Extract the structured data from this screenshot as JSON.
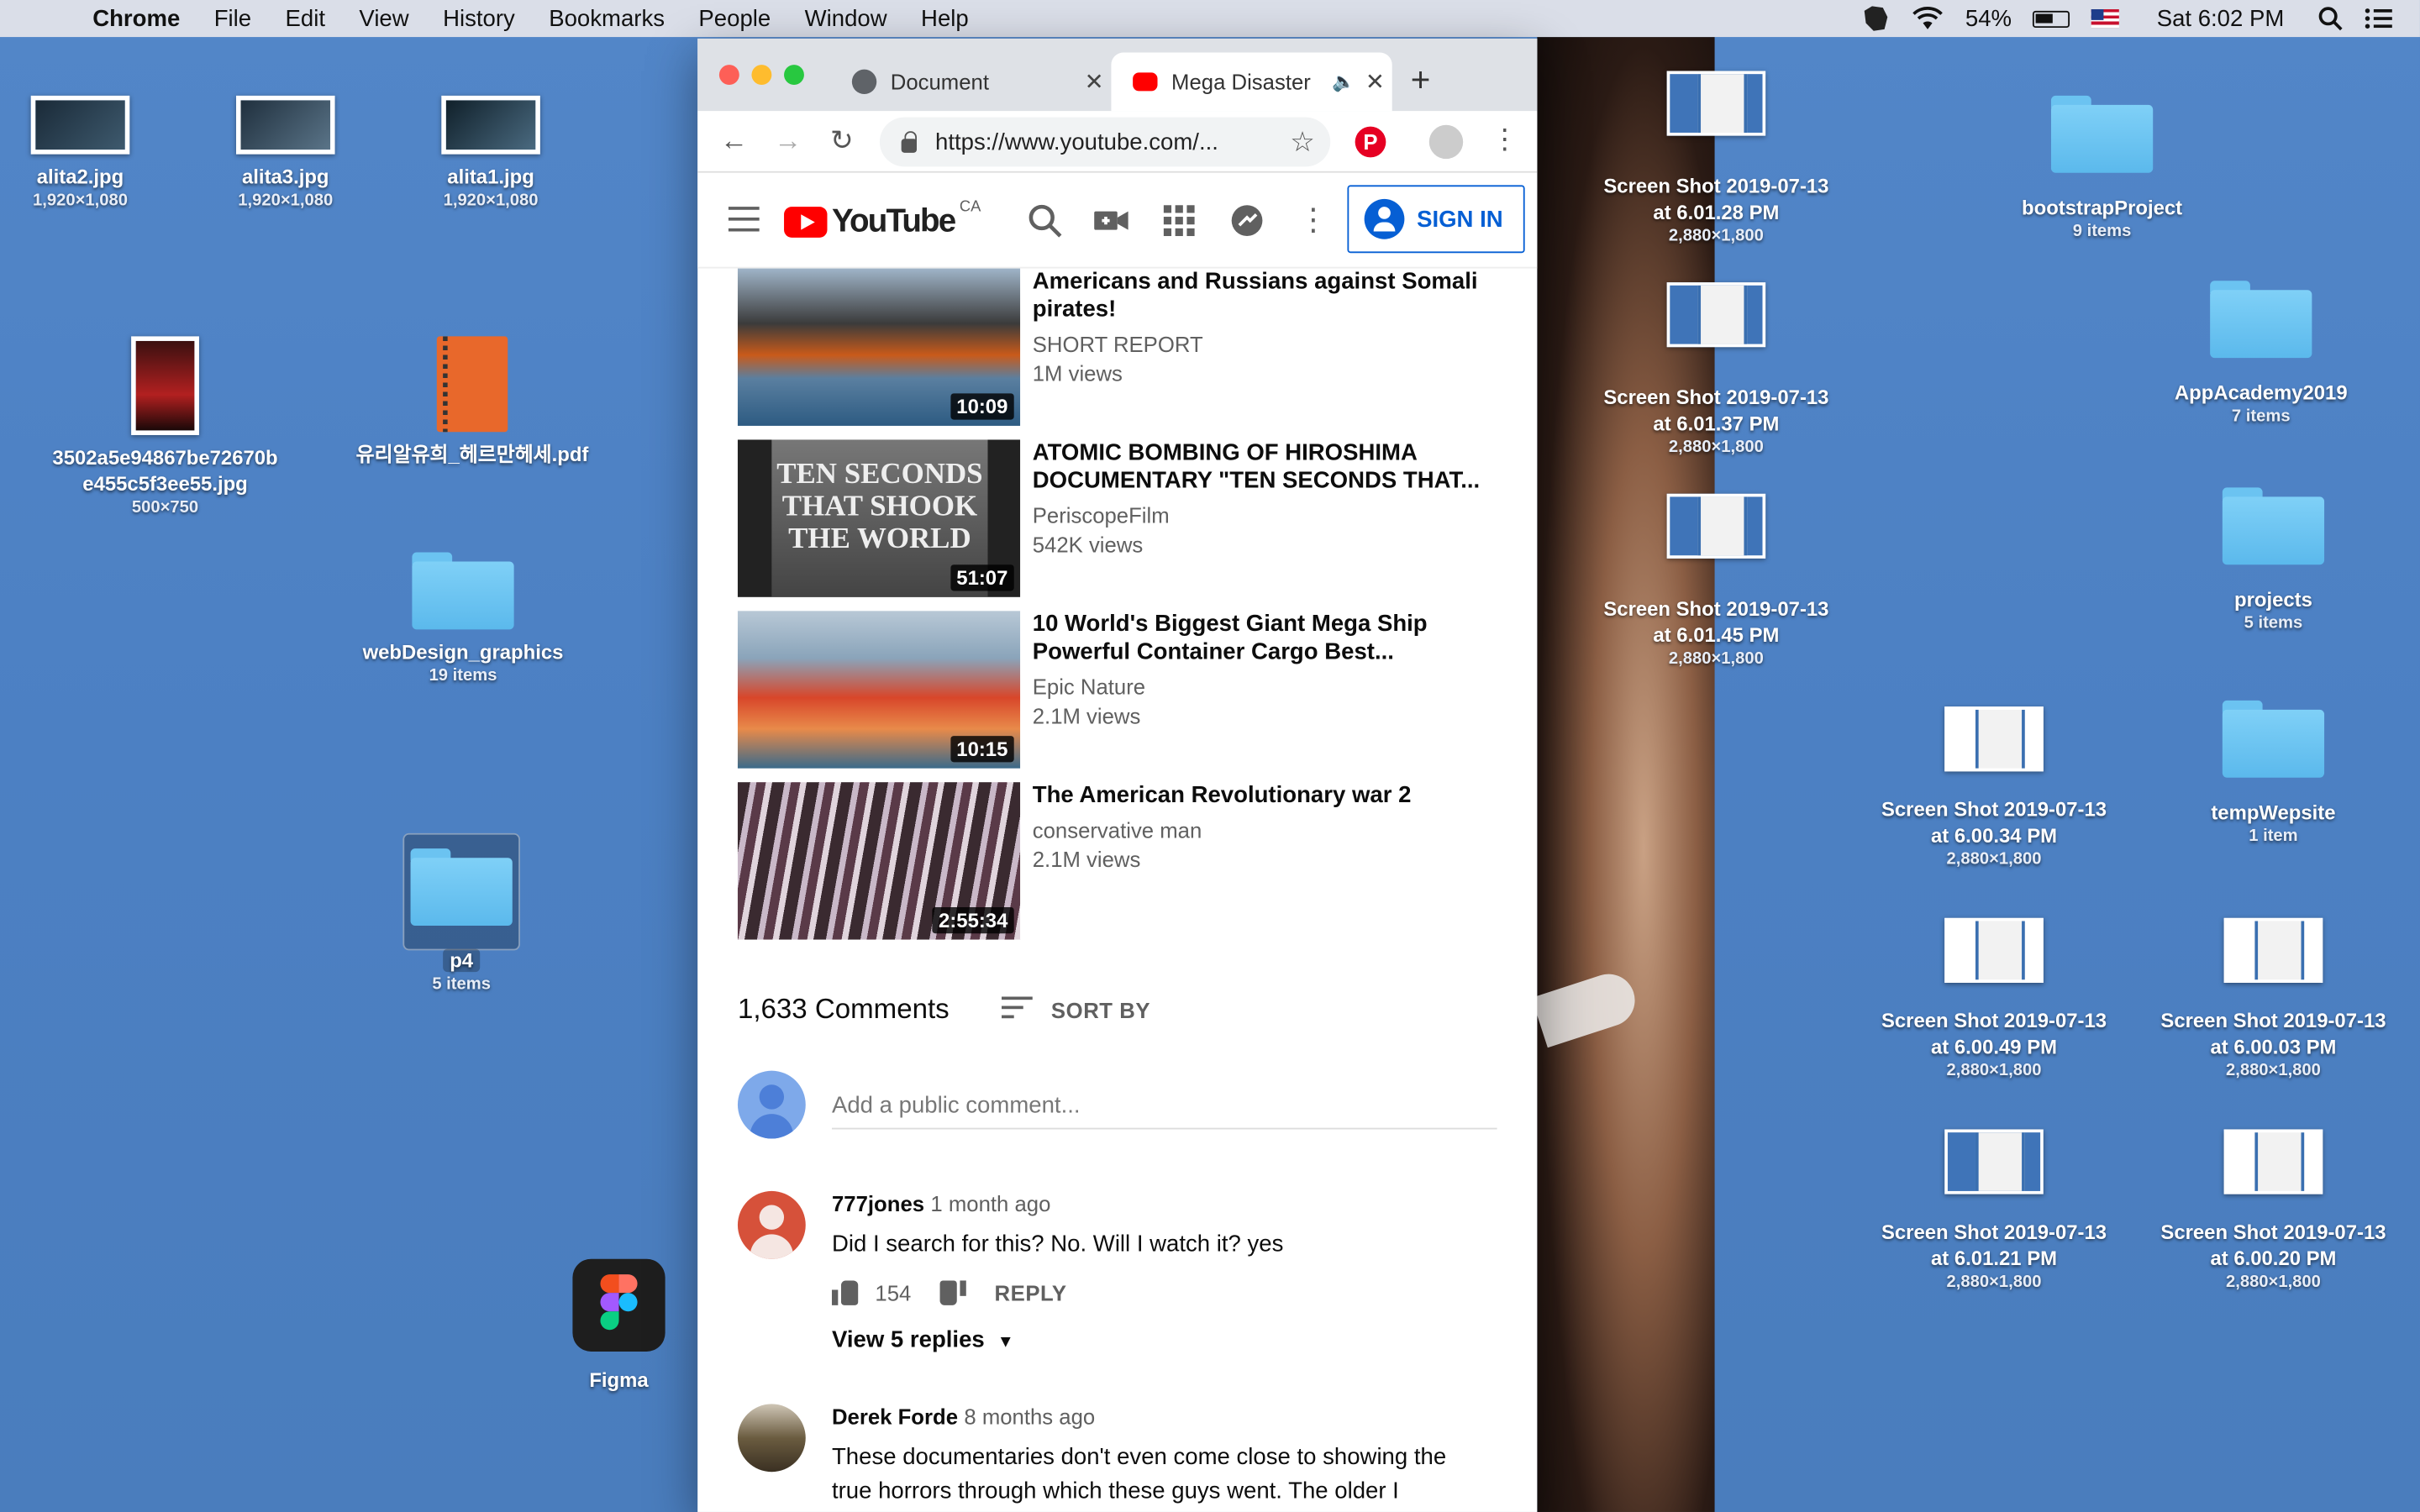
{
  "menubar": {
    "apple": "",
    "app": "Chrome",
    "items": [
      "File",
      "Edit",
      "View",
      "History",
      "Bookmarks",
      "People",
      "Window",
      "Help"
    ],
    "battery": "54%",
    "clock": "Sat 6:02 PM"
  },
  "desktop": {
    "top_images": [
      {
        "name": "alita2.jpg",
        "size": "1,920×1,080"
      },
      {
        "name": "alita3.jpg",
        "size": "1,920×1,080"
      },
      {
        "name": "alita1.jpg",
        "size": "1,920×1,080"
      }
    ],
    "poster": {
      "name": "3502a5e94867be72670b\ne455c5f3ee55.jpg",
      "size": "500×750"
    },
    "pdf": {
      "name": "유리알유희_헤르만헤세.pdf"
    },
    "webdesign": {
      "name": "webDesign_graphics",
      "sub": "19 items"
    },
    "p4": {
      "name": "p4",
      "sub": "5 items"
    },
    "figma": {
      "name": "Figma"
    },
    "screens": [
      {
        "name": "Screen Shot 2019-07-13\nat 6.01.28 PM",
        "size": "2,880×1,800"
      },
      {
        "name": "Screen Shot 2019-07-13\nat 6.01.37 PM",
        "size": "2,880×1,800"
      },
      {
        "name": "Screen Shot 2019-07-13\nat 6.01.45 PM",
        "size": "2,880×1,800"
      },
      {
        "name": "Screen Shot 2019-07-13\nat 6.00.34 PM",
        "size": "2,880×1,800"
      },
      {
        "name": "Screen Shot 2019-07-13\nat 6.00.49 PM",
        "size": "2,880×1,800"
      },
      {
        "name": "Screen Shot 2019-07-13\nat 6.00.03 PM",
        "size": "2,880×1,800"
      },
      {
        "name": "Screen Shot 2019-07-13\nat 6.01.21 PM",
        "size": "2,880×1,800"
      },
      {
        "name": "Screen Shot 2019-07-13\nat 6.00.20 PM",
        "size": "2,880×1,800"
      }
    ],
    "folders": [
      {
        "name": "bootstrapProject",
        "sub": "9 items"
      },
      {
        "name": "AppAcademy2019",
        "sub": "7 items"
      },
      {
        "name": "projects",
        "sub": "5 items"
      },
      {
        "name": "tempWepsite",
        "sub": "1 item"
      }
    ]
  },
  "browser": {
    "tabs": [
      {
        "title": "Document"
      },
      {
        "title": "Mega Disaster"
      }
    ],
    "url": "https://www.youtube.com/...",
    "pinterest": "P"
  },
  "youtube": {
    "logo_text": "YouTube",
    "country": "CA",
    "sign_in": "SIGN IN",
    "videos": [
      {
        "title": "Americans and Russians against Somali pirates!",
        "channel": "SHORT REPORT",
        "views": "1M views",
        "duration": "10:09"
      },
      {
        "title": "ATOMIC BOMBING OF HIROSHIMA DOCUMENTARY \"TEN SECONDS THAT...",
        "channel": "PeriscopeFilm",
        "views": "542K views",
        "duration": "51:07"
      },
      {
        "title": "10 World's Biggest Giant Mega Ship Powerful Container Cargo Best...",
        "channel": "Epic Nature",
        "views": "2.1M views",
        "duration": "10:15"
      },
      {
        "title": "The American Revolutionary war 2",
        "channel": "conservative man",
        "views": "2.1M views",
        "duration": "2:55:34"
      }
    ],
    "thumb2_text": "TEN SECONDS\nTHAT SHOOK\nTHE WORLD",
    "comments": {
      "count": "1,633 Comments",
      "sort_by": "SORT BY",
      "add_placeholder": "Add a public comment...",
      "items": [
        {
          "author": "777jones",
          "when": "1 month ago",
          "text": "Did I search for this?  No. Will I watch it? yes",
          "likes": "154",
          "reply": "REPLY",
          "view_replies": "View 5 replies"
        },
        {
          "author": "Derek Forde",
          "when": "8 months ago",
          "text": "These documentaries don't even come close to showing the true horrors through which these guys went. The older I"
        }
      ]
    }
  }
}
